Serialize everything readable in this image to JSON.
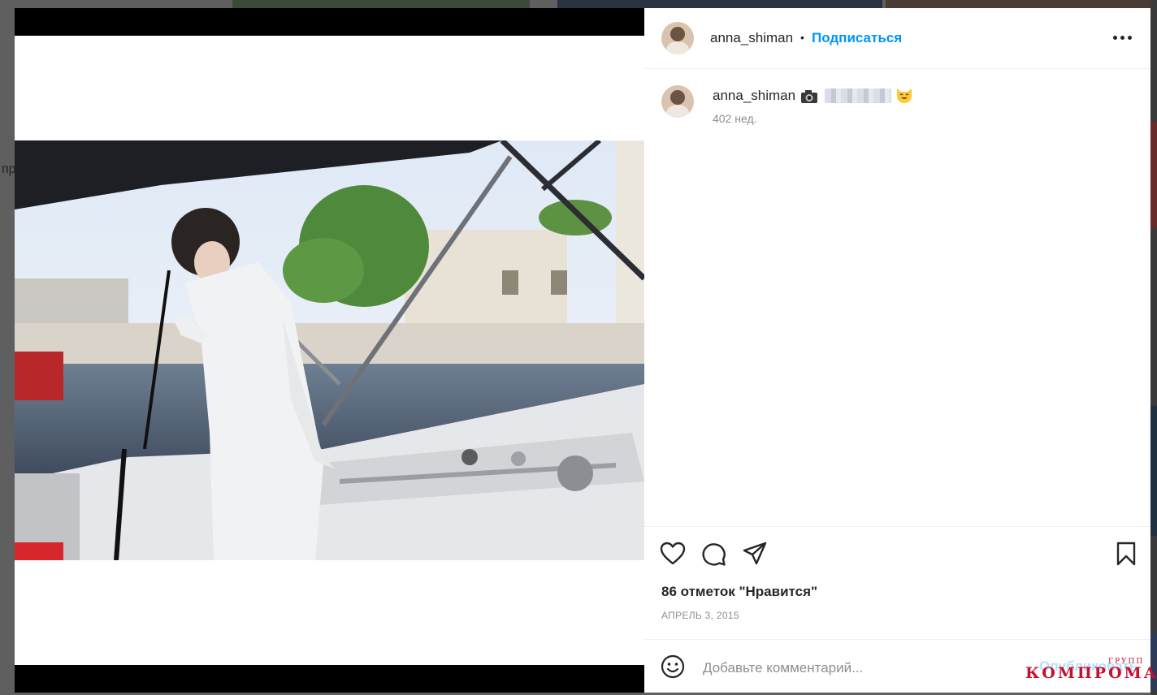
{
  "colors": {
    "accent": "#0095f6",
    "text": "#262626",
    "muted": "#8e8e8e",
    "watermark": "#c8102e"
  },
  "background": {
    "partial_text": "пр"
  },
  "post": {
    "username": "anna_shiman",
    "follow_label": "Подписаться",
    "separator": "•",
    "caption_icon": "camera-emoji",
    "caption_emoji_name": "smiling-cat-emoji",
    "time_ago": "402 нед.",
    "likes": "86 отметок \"Нравится\"",
    "date": "АПРЕЛЬ 3, 2015"
  },
  "icons": {
    "more": "more-options-icon",
    "like": "heart-icon",
    "comment": "comment-icon",
    "share": "share-icon",
    "save": "bookmark-icon",
    "emoji": "emoji-icon"
  },
  "comment": {
    "placeholder": "Добавьте комментарий...",
    "publish_label": "Опубликовать"
  },
  "watermark": {
    "top": "ГРУПП",
    "main": "КОМПРОМАТ"
  }
}
